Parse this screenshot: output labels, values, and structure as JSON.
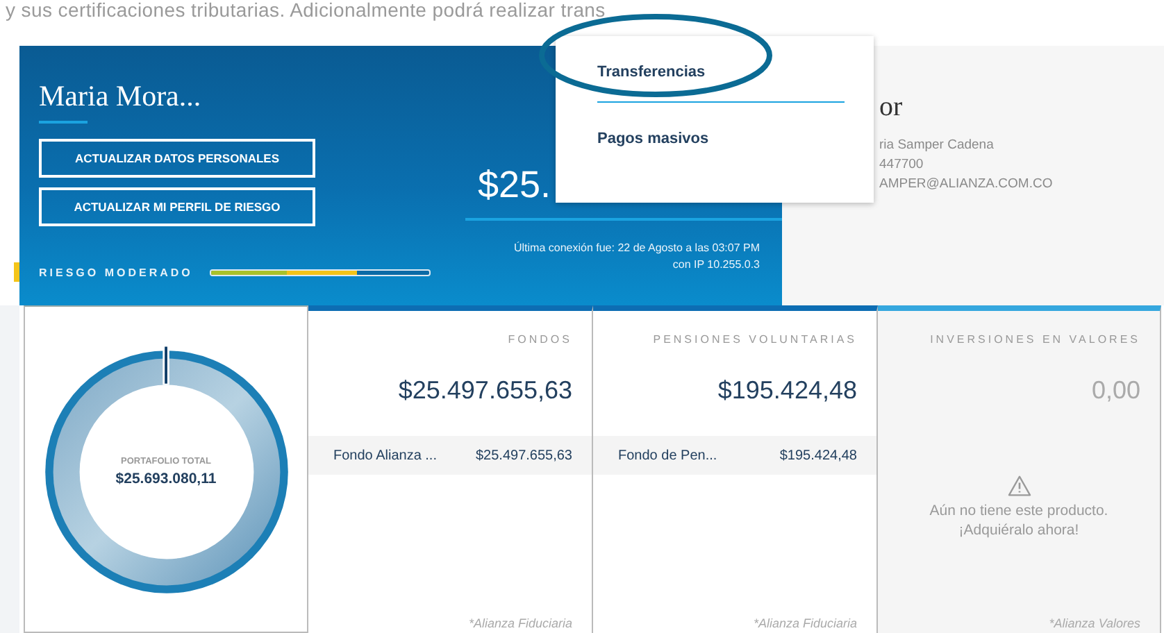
{
  "top_text": "y sus certificaciones tributarias. Adicionalmente podrá realizar trans",
  "hero": {
    "name": "Maria Mora...",
    "buttons": [
      "ACTUALIZAR DATOS PERSONALES",
      "ACTUALIZAR MI PERFIL DE RIESGO"
    ],
    "balance": "$25.",
    "last_connection": [
      "Última conexión fue: 22 de Agosto a las 03:07 PM",
      "con IP 10.255.0.3"
    ],
    "risk": {
      "label": "RIESGO MODERADO",
      "level": 0.67
    }
  },
  "advisor": {
    "title": "or",
    "lines": [
      "ria Samper Cadena",
      "447700",
      "AMPER@ALIANZA.COM.CO"
    ]
  },
  "dropdown": {
    "items": [
      {
        "label": "Transferencias",
        "circled": true
      },
      {
        "label": "Pagos masivos",
        "circled": false
      }
    ]
  },
  "portfolio": {
    "label": "PORTAFOLIO TOTAL",
    "total": "$25.693.080,11"
  },
  "products": [
    {
      "kind": "funds",
      "title": "FONDOS",
      "total": "$25.497.655,63",
      "rows": [
        {
          "name": "Fondo Alianza ...",
          "amount": "$25.497.655,63"
        }
      ],
      "footnote": "*Alianza Fiduciaria"
    },
    {
      "kind": "funds",
      "title": "PENSIONES VOLUNTARIAS",
      "total": "$195.424,48",
      "rows": [
        {
          "name": "Fondo de Pen...",
          "amount": "$195.424,48"
        }
      ],
      "footnote": "*Alianza Fiduciaria"
    },
    {
      "kind": "empty",
      "title": "INVERSIONES EN VALORES",
      "total": "0,00",
      "message": [
        "Aún no tiene este producto.",
        "¡Adquiéralo ahora!"
      ],
      "footnote": "*Alianza Valores"
    }
  ]
}
